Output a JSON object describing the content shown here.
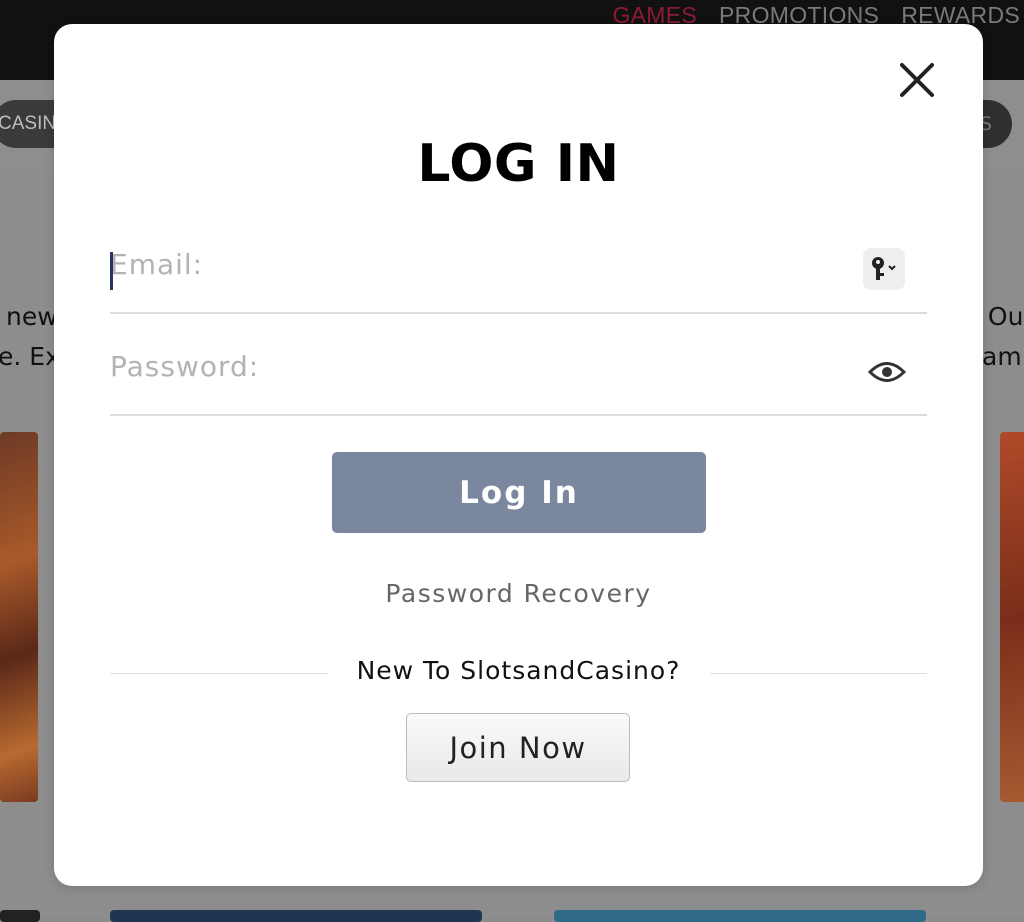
{
  "background": {
    "nav": [
      "GAMES",
      "PROMOTIONS",
      "REWARDS"
    ],
    "left_pill": "CASINO",
    "right_pill": "S",
    "text_left_1": "new",
    "text_left_2": "e. Ex",
    "text_right_1": ". Ou",
    "text_right_2": "am"
  },
  "modal": {
    "title": "LOG IN",
    "close_icon": "close-icon",
    "email": {
      "placeholder": "Email:",
      "value": "",
      "icon": "key-icon"
    },
    "password": {
      "placeholder": "Password:",
      "value": "",
      "icon": "eye-icon"
    },
    "login_button": "Log In",
    "recovery_link": "Password Recovery",
    "divider_text": "New To SlotsandCasino?",
    "join_button": "Join Now"
  },
  "colors": {
    "login_button_bg": "#7a879f",
    "nav_active": "#e0244f",
    "caret": "#2a3560"
  }
}
